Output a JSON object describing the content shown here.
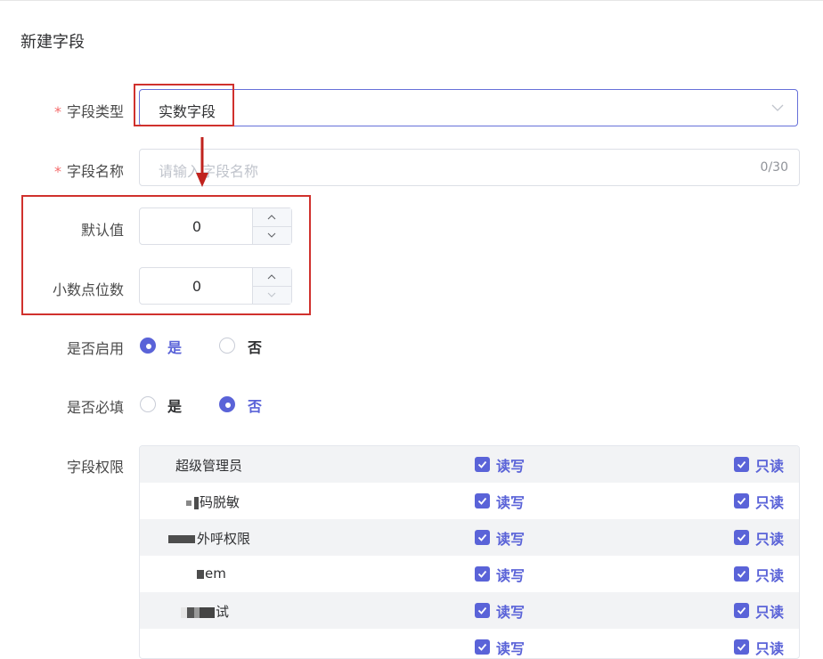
{
  "form": {
    "title": "新建字段",
    "field_type": {
      "label": "字段类型",
      "required_mark": "*",
      "value": "实数字段"
    },
    "field_name": {
      "label": "字段名称",
      "required_mark": "*",
      "placeholder": "请输入字段名称",
      "counter": "0/30"
    },
    "default_value": {
      "label": "默认值",
      "value": "0"
    },
    "decimal_places": {
      "label": "小数点位数",
      "value": "0"
    },
    "enabled": {
      "label": "是否启用",
      "options": [
        "是",
        "否"
      ],
      "selected": "是"
    },
    "required": {
      "label": "是否必填",
      "options": [
        "是",
        "否"
      ],
      "selected": "否"
    },
    "permissions": {
      "label": "字段权限",
      "rows": [
        {
          "name": "超级管理员",
          "read_write": "读写",
          "read_only": "只读"
        },
        {
          "name": "码脱敏",
          "read_write": "读写",
          "read_only": "只读"
        },
        {
          "name": "外呼权限",
          "read_write": "读写",
          "read_only": "只读"
        },
        {
          "name": "em",
          "read_write": "读写",
          "read_only": "只读"
        },
        {
          "name": "试",
          "read_write": "读写",
          "read_only": "只读"
        },
        {
          "name": "",
          "read_write": "读写",
          "read_only": "只读"
        }
      ]
    }
  },
  "colors": {
    "accent": "#5a63d8",
    "required": "#f56c6c",
    "annotation": "#d0312d"
  },
  "icons": {
    "select_arrow": "chevron-down-icon",
    "step_up": "chevron-up-icon",
    "step_down": "chevron-down-icon",
    "checkbox": "check-icon",
    "annotation_arrow": "arrow-down-icon"
  }
}
